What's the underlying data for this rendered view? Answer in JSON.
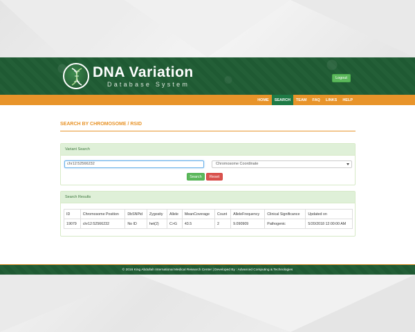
{
  "brand": {
    "title": "DNA Variation",
    "subtitle": "Database System"
  },
  "header": {
    "logout_label": "Logout"
  },
  "nav": {
    "items": [
      {
        "label": "HOME",
        "active": false
      },
      {
        "label": "SEARCH",
        "active": true
      },
      {
        "label": "TEAM",
        "active": false
      },
      {
        "label": "FAQ",
        "active": false
      },
      {
        "label": "LINKS",
        "active": false
      },
      {
        "label": "HELP",
        "active": false
      }
    ]
  },
  "page": {
    "title": "SEARCH BY CHROMOSOME / RSID"
  },
  "search_panel": {
    "heading": "Variant Search",
    "input_value": "chr12:52566232",
    "select_value": "Chromosome Coordinate",
    "search_label": "Search",
    "reset_label": "Reset"
  },
  "results_panel": {
    "heading": "Search Results",
    "columns": [
      "ID",
      "Chromosome Position",
      "DbSNPid",
      "Zygosity",
      "Allele",
      "MeanCoverage",
      "Count",
      "AlleleFrequency",
      "Clinical Significance",
      "Updated on"
    ],
    "rows": [
      [
        "19079",
        "chr12:52566232",
        "No ID",
        "het(2)",
        "C>G",
        "43.5",
        "2",
        "9.090909",
        "Pathogenic",
        "5/20/2018 12:00:00 AM"
      ]
    ]
  },
  "footer": {
    "text": "© 2016 King Abdullah International Medical Research Center | Developed By : Advanced Computing & Technologies"
  },
  "colors": {
    "header_green": "#1e5730",
    "accent_orange": "#e8942a",
    "nav_active": "#1e7a45",
    "button_green": "#5cb85c",
    "button_red": "#d9534f",
    "panel_head": "#dff0d8"
  }
}
